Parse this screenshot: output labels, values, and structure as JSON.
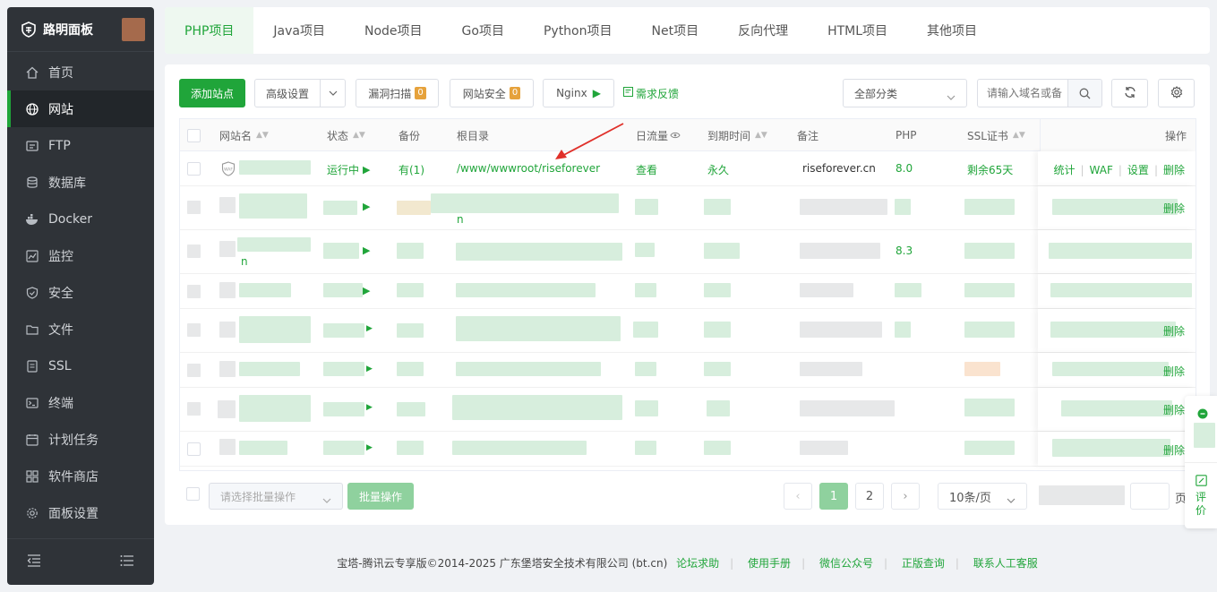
{
  "sidebar": {
    "brand": "路明面板",
    "items": [
      {
        "label": "首页",
        "icon": "home-icon"
      },
      {
        "label": "网站",
        "icon": "globe-icon"
      },
      {
        "label": "FTP",
        "icon": "ftp-icon"
      },
      {
        "label": "数据库",
        "icon": "database-icon"
      },
      {
        "label": "Docker",
        "icon": "docker-icon"
      },
      {
        "label": "监控",
        "icon": "monitor-icon"
      },
      {
        "label": "安全",
        "icon": "shield-icon"
      },
      {
        "label": "文件",
        "icon": "folder-icon"
      },
      {
        "label": "SSL",
        "icon": "ssl-icon"
      },
      {
        "label": "终端",
        "icon": "terminal-icon"
      },
      {
        "label": "计划任务",
        "icon": "calendar-icon"
      },
      {
        "label": "软件商店",
        "icon": "grid-icon"
      },
      {
        "label": "面板设置",
        "icon": "gear-icon"
      }
    ]
  },
  "tabs": [
    "PHP项目",
    "Java项目",
    "Node项目",
    "Go项目",
    "Python项目",
    "Net项目",
    "反向代理",
    "HTML项目",
    "其他项目"
  ],
  "toolbar": {
    "add_site": "添加站点",
    "advanced": "高级设置",
    "vuln_scan": "漏洞扫描",
    "vuln_count": "0",
    "site_security": "网站安全",
    "security_count": "0",
    "nginx": "Nginx",
    "feedback": "需求反馈",
    "category": "全部分类",
    "search_placeholder": "请输入域名或备"
  },
  "table": {
    "headers": {
      "name": "网站名",
      "status": "状态",
      "backup": "备份",
      "root": "根目录",
      "traffic": "日流量",
      "expire": "到期时间",
      "remark": "备注",
      "php": "PHP",
      "ssl": "SSL证书",
      "actions": "操作"
    },
    "first_row": {
      "status": "运行中",
      "backup": "有(1)",
      "root": "/www/wwwroot/riseforever",
      "traffic": "查看",
      "expire": "永久",
      "remark": "riseforever.cn",
      "php": "8.0",
      "ssl": "剩余65天",
      "act_stats": "统计",
      "act_waf": "WAF",
      "act_settings": "设置",
      "act_delete": "删除"
    },
    "row2_root_tail": "n",
    "row2_delete": "删除",
    "row3_name_tail": "n",
    "row3_php": "8.3",
    "row5_delete": "删除",
    "row6_delete": "删除",
    "row7_delete": "删除",
    "row8_delete": "删除"
  },
  "bottom": {
    "batch_placeholder": "请选择批量操作",
    "batch_button": "批量操作",
    "page_1": "1",
    "page_2": "2",
    "page_size": "10条/页",
    "jump_suffix": "页"
  },
  "footer": {
    "copyright": "宝塔-腾讯云专享版©2014-2025 广东堡塔安全技术有限公司 (bt.cn)",
    "links": [
      "论坛求助",
      "使用手册",
      "微信公众号",
      "正版查询",
      "联系人工客服"
    ]
  },
  "float_widget": {
    "review": "评价"
  },
  "colors": {
    "brand_green": "#20a53a",
    "sidebar_bg": "#2f3338",
    "badge_orange": "#e6a23c"
  }
}
